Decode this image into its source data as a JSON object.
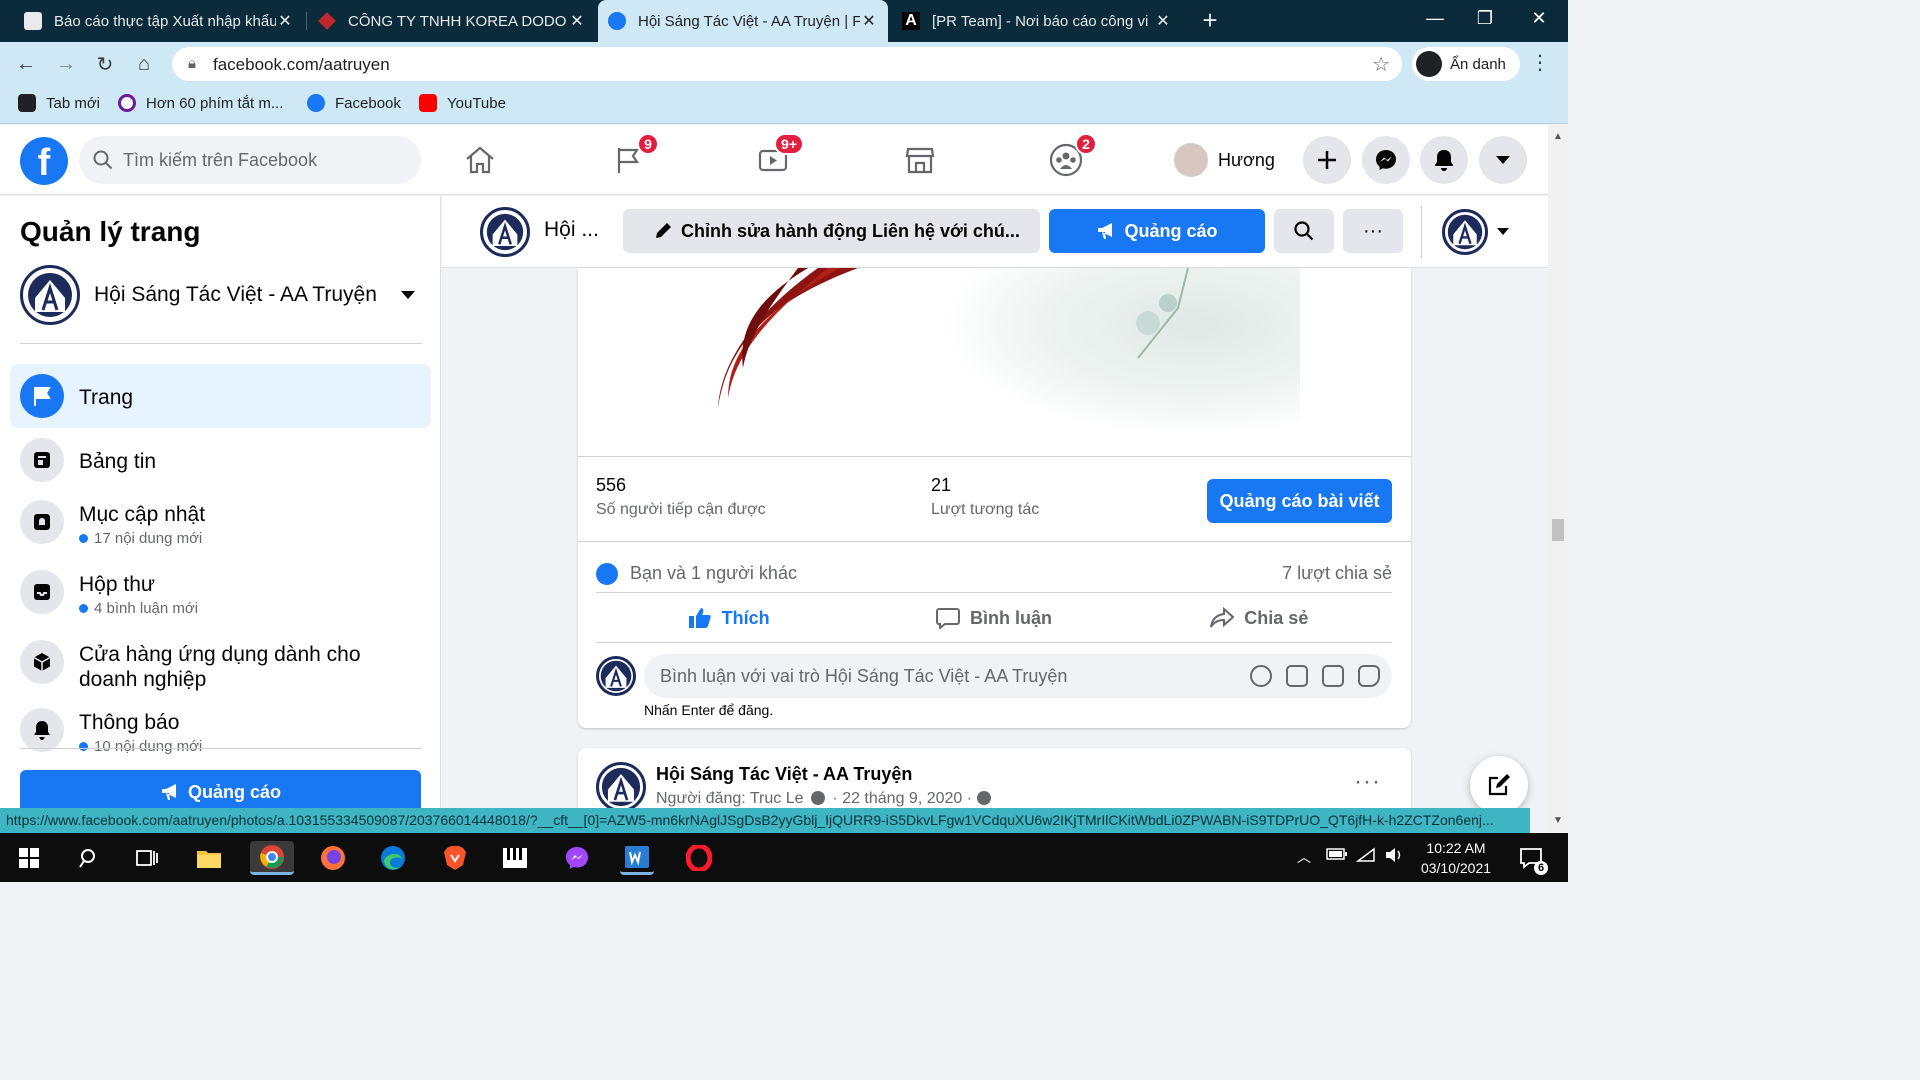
{
  "browser": {
    "tabs": [
      {
        "title": "Báo cáo thực tập Xuất nhập khẩu",
        "active": false
      },
      {
        "title": "CÔNG TY TNHH KOREA DODO D",
        "active": false
      },
      {
        "title": "Hội Sáng Tác Việt - AA Truyện | Fa",
        "active": true
      },
      {
        "title": "[PR Team] - Nơi báo cáo công vi",
        "active": false
      }
    ],
    "new_tab": "+",
    "url": "facebook.com/aatruyen",
    "profile_label": "Ẩn danh",
    "bookmarks": [
      "Tab mới",
      "Hơn 60 phím tắt m...",
      "Facebook",
      "YouTube"
    ]
  },
  "fb_header": {
    "search_placeholder": "Tìm kiếm trên Facebook",
    "badges": {
      "pages": "9",
      "watch": "9+",
      "groups": "2"
    },
    "profile_name": "Hương"
  },
  "sidebar": {
    "heading": "Quản lý trang",
    "page_name": "Hội Sáng Tác Việt - AA Truyện",
    "items": [
      {
        "label": "Trang",
        "sub": ""
      },
      {
        "label": "Bảng tin",
        "sub": ""
      },
      {
        "label": "Mục cập nhật",
        "sub": "17 nội dung mới"
      },
      {
        "label": "Hộp thư",
        "sub": "4 bình luận mới"
      },
      {
        "label": "Cửa hàng ứng dụng dành cho doanh nghiệp",
        "sub": ""
      },
      {
        "label": "Thông báo",
        "sub": "10 nội dung mới"
      }
    ],
    "ad_button": "Quảng cáo"
  },
  "page_bar": {
    "page_name_short": "Hội ...",
    "edit_button": "Chỉnh sửa hành động Liên hệ với chú...",
    "ad_button": "Quảng cáo",
    "more": "···"
  },
  "post": {
    "reach_value": "556",
    "reach_label": "Số người tiếp cận được",
    "engagement_value": "21",
    "engagement_label": "Lượt tương tác",
    "boost_button": "Quảng cáo bài viết",
    "reactions_text": "Bạn và 1 người khác",
    "shares_text": "7 lượt chia sẻ",
    "like_label": "Thích",
    "comment_label": "Bình luận",
    "share_label": "Chia sẻ",
    "comment_placeholder": "Bình luận với vai trò Hội Sáng Tác Việt - AA Truyện",
    "enter_hint": "Nhấn Enter để đăng."
  },
  "post2": {
    "author": "Hội Sáng Tác Việt - AA Truyện",
    "meta": "Người đăng: Truc Le",
    "date": "22 tháng 9, 2020",
    "more": "···"
  },
  "status_url": "https://www.facebook.com/aatruyen/photos/a.103155334509087/203766014448018/?__cft__[0]=AZW5-mn6krNAglJSgDsB2yyGblj_IjQURR9-iS5DkvLFgw1VCdquXU6w2IKjTMrIlCKitWbdLi0ZPWABN-iS9TDPrUO_QT6jfH-k-h2ZCTZon6enj...",
  "taskbar": {
    "time": "10:22 AM",
    "date": "03/10/2021",
    "notification_count": "6"
  },
  "colors": {
    "fb_blue": "#1877f2",
    "chrome_dark": "#0b2a3a",
    "chrome_light": "#cfe8f5",
    "badge_red": "#e41e3f"
  }
}
